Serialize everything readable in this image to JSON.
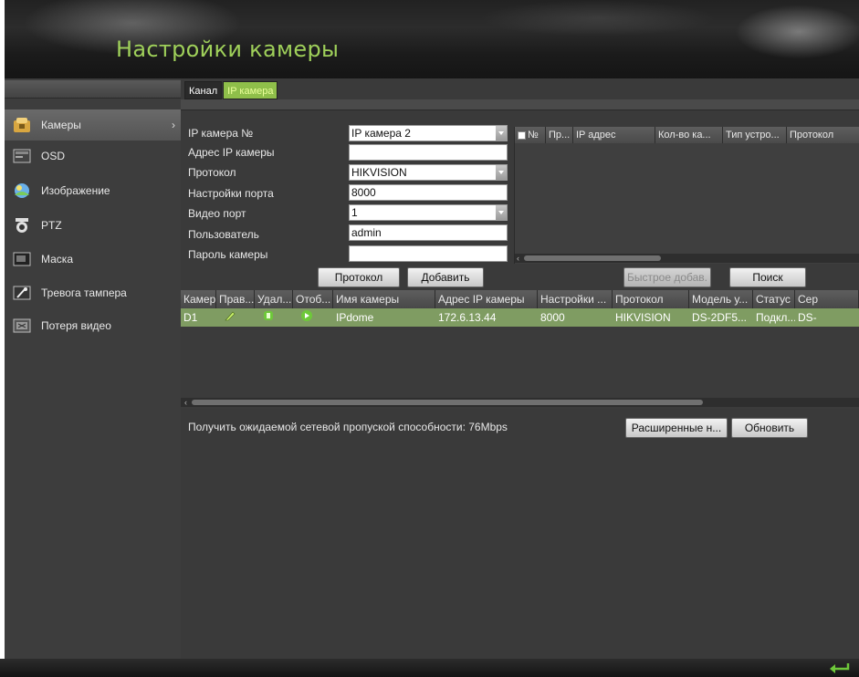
{
  "header": {
    "title": "Настройки камеры"
  },
  "sidebar": {
    "items": [
      {
        "label": "Камеры",
        "icon": "camera-folder-icon",
        "active": true,
        "arrow": "›"
      },
      {
        "label": "OSD",
        "icon": "osd-icon"
      },
      {
        "label": "Изображение",
        "icon": "image-icon"
      },
      {
        "label": "PTZ",
        "icon": "ptz-camera-icon"
      },
      {
        "label": "Маска",
        "icon": "mask-icon"
      },
      {
        "label": "Тревога тампера",
        "icon": "tamper-icon"
      },
      {
        "label": "Потеря видео",
        "icon": "video-loss-icon"
      }
    ]
  },
  "tabs": [
    {
      "label": "Канал",
      "active": false
    },
    {
      "label": "IP камера",
      "active": true
    }
  ],
  "form": {
    "camera_no_label": "IP камера №",
    "camera_no_value": "IP камера 2",
    "address_label": "Адрес IP камеры",
    "address_value": "",
    "protocol_label": "Протокол",
    "protocol_value": "HIKVISION",
    "port_label": "Настройки порта",
    "port_value": "8000",
    "video_port_label": "Видео порт",
    "video_port_value": "1",
    "user_label": "Пользователь",
    "user_value": "admin",
    "password_label": "Пароль камеры",
    "password_value": ""
  },
  "buttons": {
    "protocol": "Протокол",
    "add": "Добавить",
    "quick_add": "Быстрое добав.",
    "search": "Поиск",
    "advanced": "Расширенные н...",
    "refresh": "Обновить"
  },
  "discovered_table": {
    "headers": [
      "№",
      "Пр...",
      "IP адрес",
      "Кол-во ка...",
      "Тип устро...",
      "Протокол"
    ]
  },
  "camera_table": {
    "headers": [
      "Камер...",
      "Прав...",
      "Удал...",
      "Отоб...",
      "Имя камеры",
      "Адрес IP камеры",
      "Настройки ...",
      "Протокол",
      "Модель у...",
      "Статус",
      "Сер"
    ],
    "rows": [
      {
        "camera": "D1",
        "name": "IPdome",
        "ip": "172.6.13.44",
        "port": "8000",
        "protocol": "HIKVISION",
        "model": "DS-2DF5...",
        "status": "Подкл...",
        "serial": "DS-"
      }
    ]
  },
  "bandwidth_text": "Получить ожидаемой сетевой пропуской способности: 76Mbps",
  "colors": {
    "accent": "#9fd05a",
    "selected_row": "#7f9c62"
  }
}
